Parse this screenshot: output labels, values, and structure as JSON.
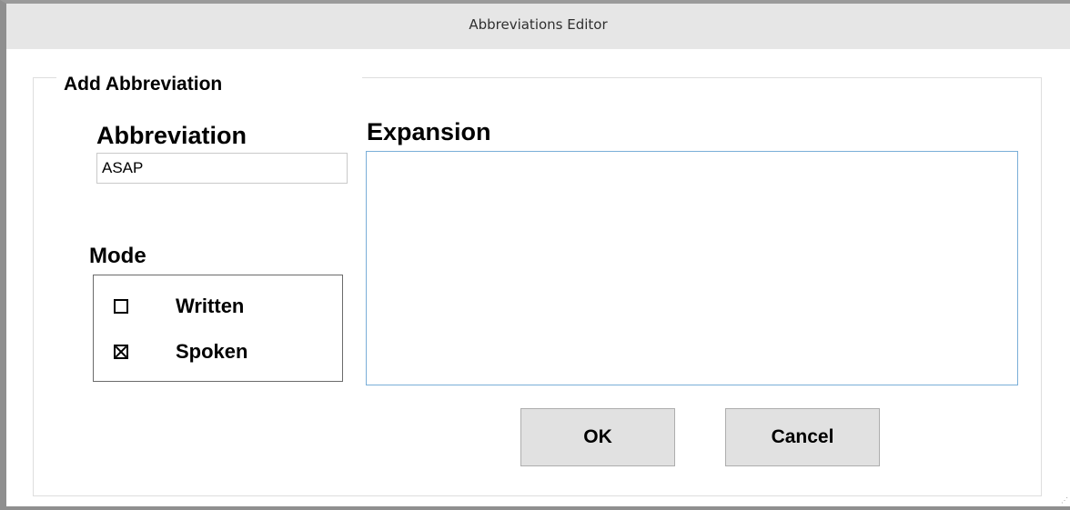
{
  "window": {
    "title": "Abbreviations Editor"
  },
  "group": {
    "label": "Add Abbreviation"
  },
  "abbreviation": {
    "label": "Abbreviation",
    "value": "ASAP"
  },
  "expansion": {
    "label": "Expansion",
    "value": ""
  },
  "mode": {
    "label": "Mode",
    "options": [
      {
        "label": "Written",
        "checked": false
      },
      {
        "label": "Spoken",
        "checked": true
      }
    ]
  },
  "buttons": {
    "ok": "OK",
    "cancel": "Cancel"
  },
  "colors": {
    "titlebar": "#e6e6e6",
    "frame": "#8f8f8f",
    "expansion_border": "#7aaed8",
    "button_face": "#e1e1e1"
  }
}
